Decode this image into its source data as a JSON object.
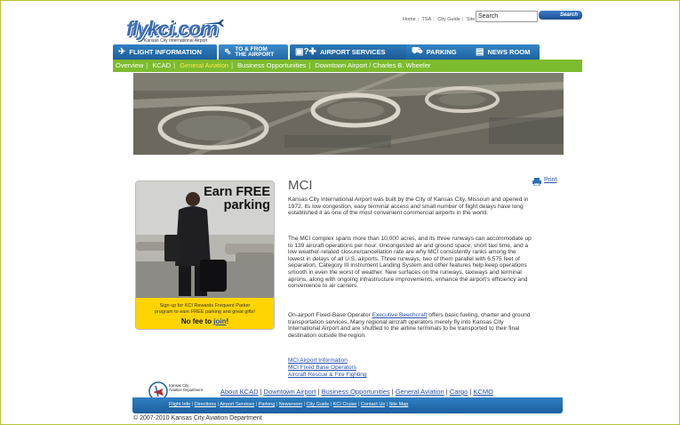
{
  "header": {
    "logo_text": "flykci.com",
    "logo_subtitle": "Kansas City International Airport",
    "top_links": [
      "Home",
      "TSA",
      "City Guide",
      "Site Map"
    ],
    "search_value": "Search",
    "search_button": "Search"
  },
  "nav": {
    "tabs": [
      {
        "label": "FLIGHT INFORMATION",
        "icon": "plane-icon"
      },
      {
        "label_line1": "TO & FROM",
        "label_line2": "THE AIRPORT",
        "icon": "arrow-icon"
      },
      {
        "label": "AIRPORT SERVICES",
        "icon": "services-icon"
      },
      {
        "label": "PARKING",
        "icon": "car-icon"
      },
      {
        "label": "NEWS ROOM",
        "icon": "newspaper-icon"
      }
    ],
    "subnav": [
      "Overview",
      "KCAD",
      "General Aviation",
      "Business Opportunities",
      "Downtown Airport / Charles B. Wheeler"
    ],
    "active_subnav": "General Aviation"
  },
  "promo": {
    "title_line1": "Earn FREE",
    "title_line2": "parking",
    "line1": "Sign up for KCI Rewards Frequent Parker",
    "line2": "program to earn FREE parking and great gifts!",
    "fee_text": "No fee to ",
    "join_link": "join",
    "fee_end": "!"
  },
  "content": {
    "title": "MCI",
    "print_label": "Print",
    "p1": "Kansas City International Airport was built by the City of Kansas City, Missouri and opened in 1972. Its low congestion, easy terminal access and small number of flight delays have long established it as one of the most convenient commercial airports in the world.",
    "p2": "The MCI complex spans more than 10,000 acres, and its three runways can accommodate up to 139 aircraft operations per hour. Uncongested air and ground space, short taxi time, and a low weather-related closure/cancellation rate are why MCI consistently ranks among the lowest in delays of all U.S. airports. Three runways, two of them parallel with 6,575 feet of separation, Category III instrument Landing System and other features help keep operations smooth in even the worst of weather. New surfaces on the runways, taxiways and terminal aprons, along with ongoing infrastructure improvements, enhance the airport's efficiency and convenience to air carriers.",
    "p3_before": "On-airport Fixed-Base Operator ",
    "p3_link": "Executive Beechcraft",
    "p3_after": " offers basic fueling, charter and ground transportation services. Many regional aircraft operators merely fly into Kansas City International Airport and are shuttled to the airline terminals to be transported to their final destination outside the region.",
    "links": [
      "MCI Airport Information",
      "MCI Fixed Base Operators",
      "Aircraft Rescue & Fire Fighting"
    ]
  },
  "footer": {
    "logo_line1": "Kansas City",
    "logo_line2": "Aviation Department",
    "links": [
      "About KCAD",
      "Downtown Airport",
      "Business Opportunities",
      "General Aviation",
      "Cargo",
      "KCMO"
    ],
    "bar_links": [
      "Flight Info",
      "Directions",
      "Airport Services",
      "Parking",
      "Newsroom",
      "City Guide",
      "KCI Cruise",
      "Contact Us",
      "Site Map"
    ],
    "copyright": "© 2007-2010 Kansas City Aviation Department"
  },
  "colors": {
    "brand_blue": "#1c5f9e",
    "subnav_green": "#7dbb2f",
    "active_yellow": "#ffe84a",
    "promo_yellow": "#ffd400",
    "link_blue": "#2a4fa8"
  }
}
